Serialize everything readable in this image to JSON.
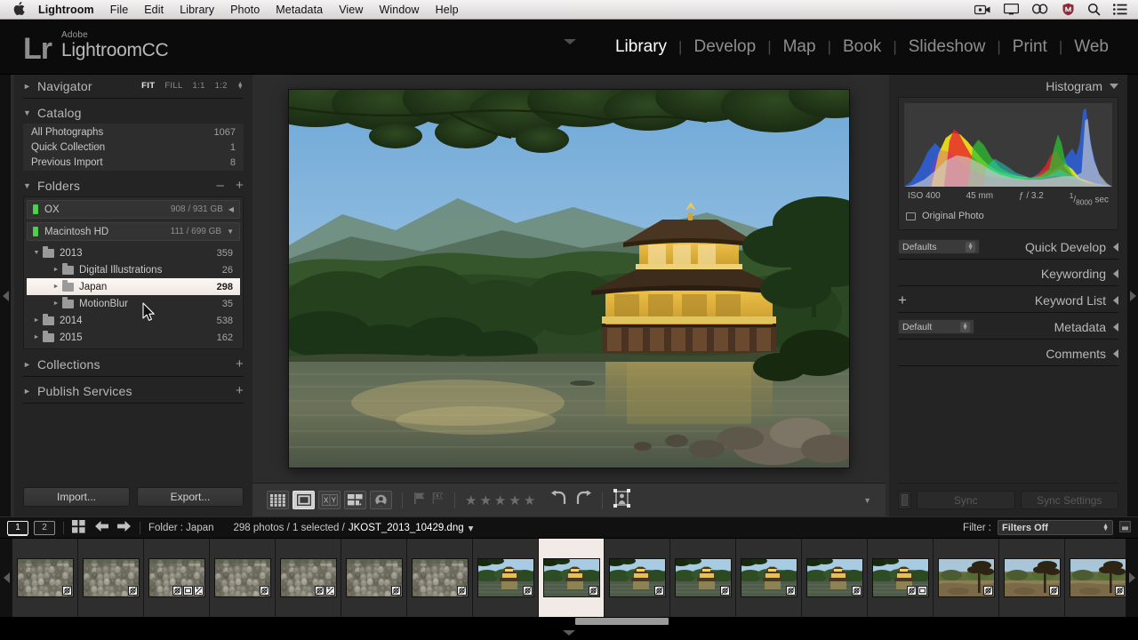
{
  "macbar": {
    "apple_icon": "apple-icon",
    "items": [
      {
        "label": "Lightroom",
        "bold": true
      },
      {
        "label": "File",
        "bold": false
      },
      {
        "label": "Edit",
        "bold": false
      },
      {
        "label": "Library",
        "bold": false
      },
      {
        "label": "Photo",
        "bold": false
      },
      {
        "label": "Metadata",
        "bold": false
      },
      {
        "label": "View",
        "bold": false
      },
      {
        "label": "Window",
        "bold": false
      },
      {
        "label": "Help",
        "bold": false
      }
    ],
    "status_icons": [
      "screen-record-icon",
      "display-icon",
      "creative-cloud-icon",
      "shield-icon",
      "search-icon",
      "list-menu-icon"
    ]
  },
  "identity": {
    "logo_mark": "Lr",
    "brand": "Adobe",
    "product": "LightroomCC"
  },
  "modules": {
    "items": [
      "Library",
      "Develop",
      "Map",
      "Book",
      "Slideshow",
      "Print",
      "Web"
    ],
    "active": "Library"
  },
  "left_panel": {
    "navigator": {
      "title": "Navigator",
      "modes": [
        "FIT",
        "FILL",
        "1:1",
        "1:2"
      ],
      "active_mode": "FIT"
    },
    "catalog": {
      "title": "Catalog",
      "items": [
        {
          "label": "All Photographs",
          "count": "1067",
          "plus": false
        },
        {
          "label": "Quick Collection",
          "count": "1",
          "plus": true
        },
        {
          "label": "Previous Import",
          "count": "8",
          "plus": false
        }
      ]
    },
    "folders": {
      "title": "Folders",
      "minus_label": "–",
      "plus_label": "+",
      "volumes": [
        {
          "name": "OX",
          "size": "908 / 931 GB",
          "state": "collapsed"
        },
        {
          "name": "Macintosh HD",
          "size": "111 / 699 GB",
          "state": "expanded"
        }
      ],
      "tree": [
        {
          "label": "2013",
          "count": "359",
          "depth": 0,
          "twisty": "down",
          "selected": false
        },
        {
          "label": "Digital Illustrations",
          "count": "26",
          "depth": 1,
          "twisty": "right",
          "selected": false
        },
        {
          "label": "Japan",
          "count": "298",
          "depth": 1,
          "twisty": "right",
          "selected": true
        },
        {
          "label": "MotionBlur",
          "count": "35",
          "depth": 1,
          "twisty": "right",
          "selected": false
        },
        {
          "label": "2014",
          "count": "538",
          "depth": 0,
          "twisty": "right",
          "selected": false
        },
        {
          "label": "2015",
          "count": "162",
          "depth": 0,
          "twisty": "right",
          "selected": false
        }
      ]
    },
    "collections": {
      "title": "Collections",
      "plus_label": "+"
    },
    "publish_services": {
      "title": "Publish Services",
      "plus_label": "+"
    },
    "buttons": {
      "import": "Import...",
      "export": "Export..."
    }
  },
  "right_panel": {
    "histogram": {
      "title": "Histogram",
      "exif": {
        "iso": "ISO 400",
        "focal": "45 mm",
        "aperture": "ƒ / 3.2",
        "shutter_num": "1",
        "shutter_den": "8000",
        "shutter_unit": "sec"
      },
      "original_photo": "Original Photo"
    },
    "sections": [
      {
        "title": "Quick Develop",
        "control": "Defaults",
        "has_select": true,
        "has_plus": false
      },
      {
        "title": "Keywording",
        "control": "",
        "has_select": false,
        "has_plus": false
      },
      {
        "title": "Keyword List",
        "control": "+",
        "has_select": false,
        "has_plus": true
      },
      {
        "title": "Metadata",
        "control": "Default",
        "has_select": true,
        "has_plus": false
      },
      {
        "title": "Comments",
        "control": "",
        "has_select": false,
        "has_plus": false
      }
    ],
    "sync": {
      "sync_label": "Sync",
      "sync_settings_label": "Sync Settings"
    }
  },
  "toolbar": {
    "view_modes": [
      {
        "name": "grid-view-icon",
        "active": false
      },
      {
        "name": "loupe-view-icon",
        "active": true
      },
      {
        "name": "compare-view-icon",
        "active": false
      },
      {
        "name": "survey-view-icon",
        "active": false
      },
      {
        "name": "people-view-icon",
        "active": false
      }
    ],
    "flags": [
      "flag-pick-icon",
      "flag-reject-icon"
    ],
    "rating_stars": 5,
    "rotate": [
      "rotate-left-icon",
      "rotate-right-icon"
    ],
    "crop": "crop-overlay-icon",
    "caret": "chevron-down-icon"
  },
  "filmstrip_bar": {
    "screen1": "1",
    "screen2": "2",
    "grid_icon": "grid-toggle-icon",
    "back_icon": "back-arrow-icon",
    "forward_icon": "forward-arrow-icon",
    "source_label": "Folder : Japan",
    "photo_count": "298 photos / 1 selected /",
    "filename": "JKOST_2013_10429.dng",
    "filename_caret": "▾",
    "filter_label": "Filter :",
    "filter_value": "Filters Off"
  },
  "filmstrip": {
    "selected_index": 8,
    "thumbnails": [
      {
        "scene": "stones",
        "badges": [
          "develop"
        ]
      },
      {
        "scene": "stones",
        "badges": [
          "develop"
        ]
      },
      {
        "scene": "stones",
        "badges": [
          "develop",
          "crop",
          "adjust"
        ]
      },
      {
        "scene": "stones",
        "badges": [
          "develop"
        ]
      },
      {
        "scene": "stones",
        "badges": [
          "develop",
          "adjust"
        ]
      },
      {
        "scene": "stones",
        "badges": [
          "develop"
        ]
      },
      {
        "scene": "stones",
        "badges": [
          "develop"
        ]
      },
      {
        "scene": "pavilion",
        "badges": [
          "develop"
        ]
      },
      {
        "scene": "pavilion",
        "badges": [
          "develop"
        ]
      },
      {
        "scene": "pavilion",
        "badges": [
          "develop"
        ]
      },
      {
        "scene": "pavilion",
        "badges": [
          "develop"
        ]
      },
      {
        "scene": "pavilion",
        "badges": [
          "develop"
        ]
      },
      {
        "scene": "pavilion",
        "badges": [
          "develop"
        ]
      },
      {
        "scene": "pavilion",
        "badges": [
          "develop",
          "crop"
        ]
      },
      {
        "scene": "autumn",
        "badges": [
          "develop"
        ]
      },
      {
        "scene": "autumn",
        "badges": [
          "develop"
        ]
      },
      {
        "scene": "autumn",
        "badges": [
          "develop"
        ]
      }
    ]
  },
  "main_photo": {
    "subject": "golden-pavilion-kinkakuji",
    "alt": "Kinkaku-ji golden pavilion reflected in pond with pine trees"
  },
  "colors": {
    "panel_bg": "#242424",
    "stage_bg": "#2c2c2c",
    "selection": "#f2eae6",
    "text": "#b4b4b4",
    "accent_green": "#4fd24f"
  }
}
